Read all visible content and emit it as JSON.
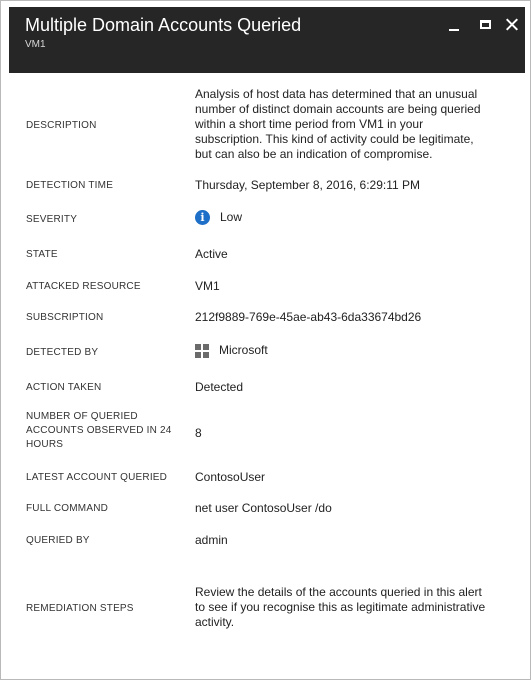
{
  "window": {
    "title": "Multiple Domain Accounts Queried",
    "subtitle": "VM1",
    "controls": [
      "minimize",
      "maximize",
      "close"
    ]
  },
  "fields": {
    "description": {
      "label": "DESCRIPTION",
      "lines": [
        "Analysis of host data has determined that an unusual",
        "number of distinct domain accounts are being queried",
        "within a short time period from VM1 in your",
        "subscription. This kind of activity could be legitimate,",
        "but can also be an indication of compromise."
      ]
    },
    "detection_time": {
      "label": "DETECTION TIME",
      "value": "Thursday, September 8, 2016, 6:29:11 PM"
    },
    "severity": {
      "label": "SEVERITY",
      "value": "Low",
      "icon": "info-icon",
      "icon_color": "#1e6fc7"
    },
    "state": {
      "label": "STATE",
      "value": "Active"
    },
    "attacked_resource": {
      "label": "ATTACKED RESOURCE",
      "value": "VM1"
    },
    "subscription": {
      "label": "SUBSCRIPTION",
      "value": "212f9889-769e-45ae-ab43-6da33674bd26"
    },
    "detected_by": {
      "label": "DETECTED BY",
      "value": "Microsoft",
      "icon": "windows-logo-icon"
    },
    "action_taken": {
      "label": "ACTION TAKEN",
      "value": "Detected"
    },
    "queried_accounts": {
      "label_lines": [
        "NUMBER OF QUERIED",
        "ACCOUNTS OBSERVED IN 24",
        "HOURS"
      ],
      "value": "8"
    },
    "latest_account": {
      "label": "LATEST ACCOUNT QUERIED",
      "value": "ContosoUser"
    },
    "full_command": {
      "label": "FULL COMMAND",
      "value": "net user ContosoUser /do"
    },
    "queried_by": {
      "label": "QUERIED BY",
      "value": "admin"
    },
    "remediation": {
      "label": "REMEDIATION STEPS",
      "lines": [
        "Review the details of the accounts queried in this alert",
        "to see if you recognise this as legitimate administrative",
        "activity."
      ]
    }
  },
  "colors": {
    "header_bg": "#262626",
    "info_blue": "#1e6fc7"
  }
}
